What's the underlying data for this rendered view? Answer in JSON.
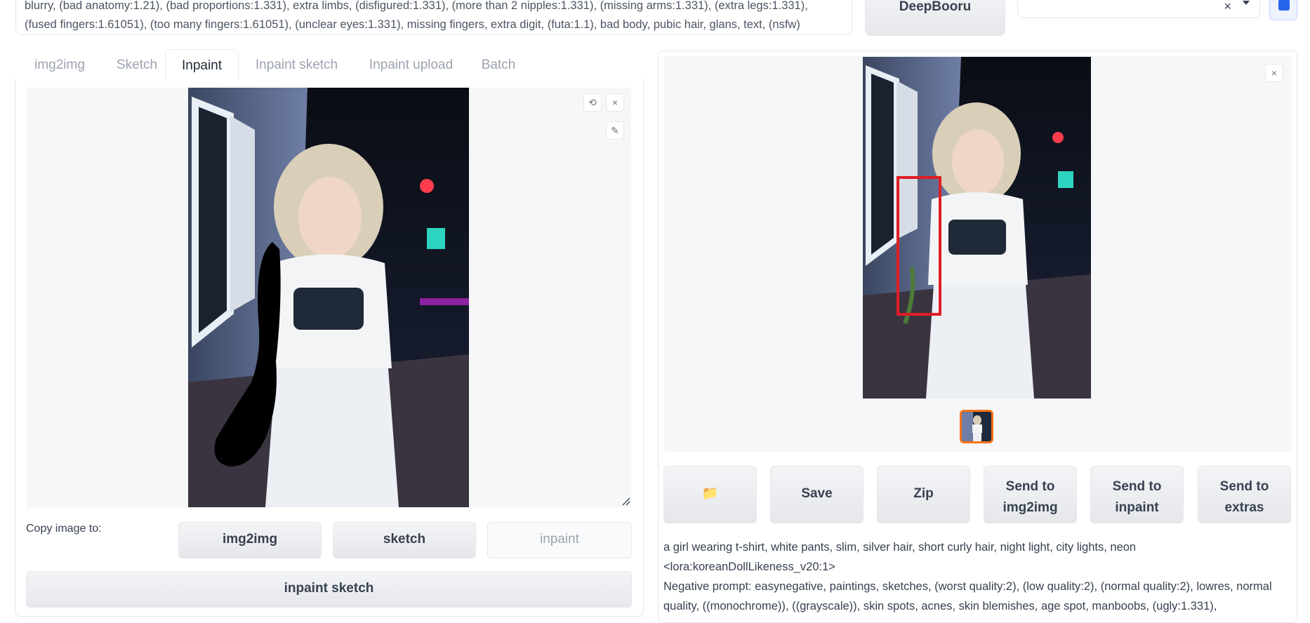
{
  "top": {
    "negative_prompt": "blurry, (bad anatomy:1.21), (bad proportions:1.331), extra limbs, (disfigured:1.331), (more than 2 nipples:1.331), (missing arms:1.331), (extra legs:1.331), (fused fingers:1.61051), (too many fingers:1.61051), (unclear eyes:1.331), missing fingers, extra digit, (futa:1.1), bad body, pubic hair, glans, text, (nsfw)",
    "deepbooru_label": "DeepBooru",
    "dropdown_clear": "×"
  },
  "tabs": [
    {
      "label": "img2img"
    },
    {
      "label": "Sketch"
    },
    {
      "label": "Inpaint"
    },
    {
      "label": "Inpaint sketch"
    },
    {
      "label": "Inpaint upload"
    },
    {
      "label": "Batch"
    }
  ],
  "active_tab": "Inpaint",
  "canvas": {
    "undo_icon": "⟲",
    "clear_icon": "×",
    "brush_icon": "✎"
  },
  "copy": {
    "label": "Copy image to:",
    "img2img": "img2img",
    "sketch": "sketch",
    "inpaint": "inpaint",
    "inpaint_sketch": "inpaint sketch"
  },
  "gallery": {
    "close_icon": "×"
  },
  "actions": {
    "folder_icon": "📁",
    "save": "Save",
    "zip": "Zip",
    "send_img2img_line1": "Send to",
    "send_img2img_line2": "img2img",
    "send_inpaint_line1": "Send to",
    "send_inpaint_line2": "inpaint",
    "send_extras_line1": "Send to",
    "send_extras_line2": "extras"
  },
  "generation_info": {
    "prompt": "a girl wearing t-shirt, white pants, slim, silver hair, short curly hair, night light, city lights, neon <lora:koreanDollLikeness_v20:1>",
    "negative": "Negative prompt: easynegative, paintings, sketches, (worst quality:2), (low quality:2), (normal quality:2), lowres, normal quality, ((monochrome)), ((grayscale)), skin spots, acnes, skin blemishes, age spot, manboobs, (ugly:1.331),"
  },
  "colors": {
    "accent_orange": "#f97316",
    "mask_red": "#e11d26",
    "refresh_blue": "#2563eb"
  }
}
